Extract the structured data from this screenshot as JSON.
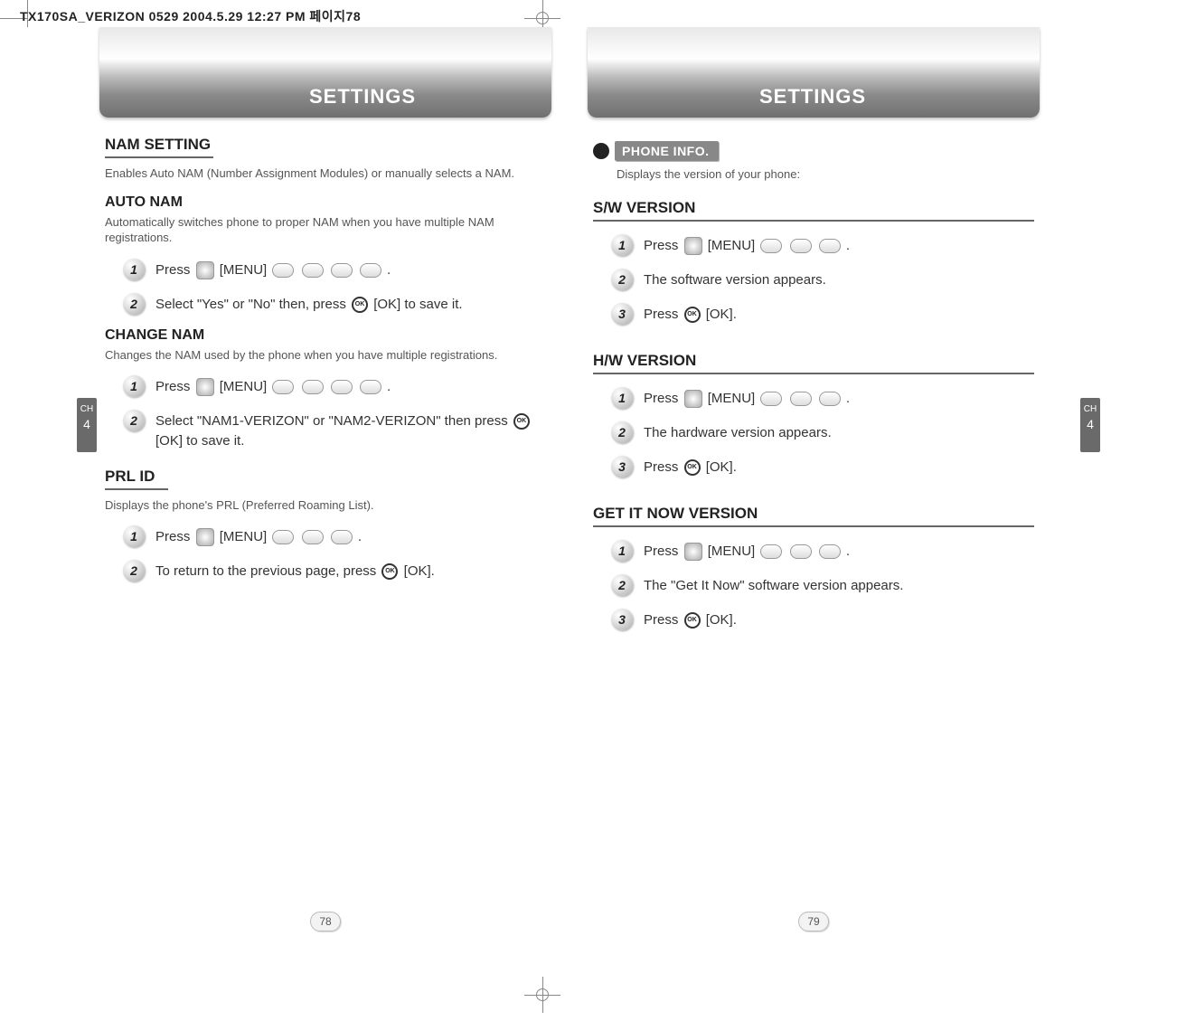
{
  "doc_header": "TX170SA_VERIZON 0529  2004.5.29 12:27 PM  페이지78",
  "chapter_tab": {
    "label": "CH",
    "number": "4"
  },
  "left": {
    "banner": "SETTINGS",
    "page_number": "78",
    "nam_setting": {
      "title": "NAM SETTING",
      "desc": "Enables Auto NAM (Number Assignment Modules) or manually selects a NAM."
    },
    "auto_nam": {
      "title": "AUTO NAM",
      "desc": "Automatically switches phone to proper NAM when you have multiple NAM registrations.",
      "steps": [
        {
          "n": "1",
          "pre": "Press",
          "mid": "[MENU]",
          "post": "."
        },
        {
          "n": "2",
          "text": "Select \"Yes\" or \"No\" then, press",
          "after": "[OK] to save it."
        }
      ]
    },
    "change_nam": {
      "title": "CHANGE NAM",
      "desc": "Changes the NAM used by the phone when you have multiple registrations.",
      "steps": [
        {
          "n": "1",
          "pre": "Press",
          "mid": "[MENU]",
          "post": "."
        },
        {
          "n": "2",
          "text": "Select \"NAM1-VERIZON\" or \"NAM2-VERIZON\" then press",
          "after": "[OK] to save it."
        }
      ]
    },
    "prl_id": {
      "title": "PRL ID",
      "desc": "Displays the phone's PRL (Preferred Roaming List).",
      "steps": [
        {
          "n": "1",
          "pre": "Press",
          "mid": "[MENU]",
          "post": "."
        },
        {
          "n": "2",
          "text": "To return to the previous page, press",
          "after": "[OK]."
        }
      ]
    }
  },
  "right": {
    "banner": "SETTINGS",
    "page_number": "79",
    "phone_info": {
      "tag": "PHONE INFO.",
      "desc": "Displays the version of your phone:"
    },
    "sw_version": {
      "title": "S/W VERSION",
      "steps": [
        {
          "n": "1",
          "pre": "Press",
          "mid": "[MENU]",
          "post": "."
        },
        {
          "n": "2",
          "text": "The software version appears."
        },
        {
          "n": "3",
          "pre": "Press",
          "after": "[OK]."
        }
      ]
    },
    "hw_version": {
      "title": "H/W VERSION",
      "steps": [
        {
          "n": "1",
          "pre": "Press",
          "mid": "[MENU]",
          "post": "."
        },
        {
          "n": "2",
          "text": "The hardware version appears."
        },
        {
          "n": "3",
          "pre": "Press",
          "after": "[OK]."
        }
      ]
    },
    "get_it_now": {
      "title": "GET IT NOW VERSION",
      "steps": [
        {
          "n": "1",
          "pre": "Press",
          "mid": "[MENU]",
          "post": "."
        },
        {
          "n": "2",
          "text": "The \"Get It Now\" software version appears."
        },
        {
          "n": "3",
          "pre": "Press",
          "after": "[OK]."
        }
      ]
    }
  }
}
